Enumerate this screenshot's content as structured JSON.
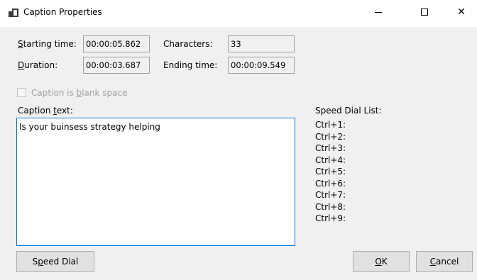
{
  "window": {
    "title": "Caption Properties",
    "controls": {
      "minimize": "—",
      "maximize": "",
      "close": "✕"
    }
  },
  "fields": {
    "starting_time": {
      "label_key": "S",
      "label_rest": "tarting time:",
      "value": "00:00:05.862"
    },
    "characters": {
      "label": "Characters:",
      "value": "33"
    },
    "duration": {
      "label_key": "D",
      "label_rest": "uration:",
      "value": "00:00:03.687"
    },
    "ending_time": {
      "label": "Ending time:",
      "value": "00:00:09.549"
    }
  },
  "blank_space": {
    "label_pre": "Caption is ",
    "label_key": "b",
    "label_post": "lank space",
    "checked": false
  },
  "caption_text": {
    "label_pre": "Caption ",
    "label_key": "t",
    "label_post": "ext:",
    "value": "Is your buinsess strategy helping"
  },
  "speed_dial": {
    "title": "Speed Dial List:",
    "items": [
      "Ctrl+1:",
      "Ctrl+2:",
      "Ctrl+3:",
      "Ctrl+4:",
      "Ctrl+5:",
      "Ctrl+6:",
      "Ctrl+7:",
      "Ctrl+8:",
      "Ctrl+9:"
    ]
  },
  "buttons": {
    "speed_dial": {
      "pre": "S",
      "key": "p",
      "post": "eed Dial"
    },
    "ok": {
      "key": "O",
      "post": "K"
    },
    "cancel": {
      "key": "C",
      "post": "ancel"
    }
  },
  "colors": {
    "window_bg": "#f0f0f0",
    "titlebar_bg": "#ffffff",
    "focus_border": "#0078d7",
    "disabled_text": "#a0a0a0"
  }
}
